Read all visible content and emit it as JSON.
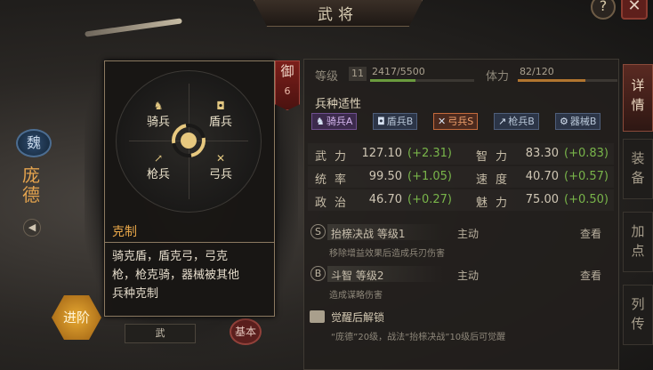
{
  "header": {
    "title": "武将"
  },
  "buttons": {
    "help": "?",
    "close": "✕"
  },
  "hero": {
    "faction": "魏",
    "name": "庞德",
    "advance_label": "进阶",
    "bottom_name": "武",
    "bottom_stamp": "基本"
  },
  "defense_badge": {
    "label": "御",
    "value": "6"
  },
  "tooltip": {
    "units": {
      "cavalry": {
        "icon": "horse-icon",
        "label": "骑兵"
      },
      "shield": {
        "icon": "shield-icon",
        "label": "盾兵"
      },
      "spear": {
        "icon": "spear-icon",
        "label": "枪兵"
      },
      "bow": {
        "icon": "bow-icon",
        "label": "弓兵"
      }
    },
    "title": "克制",
    "lines": [
      "骑克盾，盾克弓，弓克",
      "枪，枪克骑，器械被其他",
      "兵种克制"
    ]
  },
  "stats_header": {
    "level_label": "等级",
    "level": "11",
    "exp_text": "2417/5500",
    "exp_fraction": 0.44,
    "stamina_label": "体力",
    "stamina_text": "82/120",
    "stamina_fraction": 0.68
  },
  "affinity": {
    "title": "兵种适性",
    "chips": [
      {
        "icon": "horse-icon",
        "glyph": "♞",
        "label": "骑兵A",
        "grade": "A"
      },
      {
        "icon": "shield-icon",
        "glyph": "◘",
        "label": "盾兵B",
        "grade": "B"
      },
      {
        "icon": "bow-icon",
        "glyph": "✕",
        "label": "弓兵S",
        "grade": "S"
      },
      {
        "icon": "spear-icon",
        "glyph": "↗",
        "label": "枪兵B",
        "grade": "B"
      },
      {
        "icon": "machine-icon",
        "glyph": "⚙",
        "label": "器械B",
        "grade": "B"
      }
    ]
  },
  "stats": [
    {
      "name": "武力",
      "value": "127.10",
      "bonus": "(+2.31)"
    },
    {
      "name": "智力",
      "value": "83.30",
      "bonus": "(+0.83)"
    },
    {
      "name": "统率",
      "value": "99.50",
      "bonus": "(+1.05)"
    },
    {
      "name": "速度",
      "value": "40.70",
      "bonus": "(+0.57)"
    },
    {
      "name": "政治",
      "value": "46.70",
      "bonus": "(+0.27)"
    },
    {
      "name": "魅力",
      "value": "75.00",
      "bonus": "(+0.50)"
    }
  ],
  "skills": [
    {
      "grade": "S",
      "name": "抬榇决战 等级1",
      "type": "主动",
      "view": "查看",
      "desc": "移除增益效果后造成兵刃伤害"
    },
    {
      "grade": "B",
      "name": "斗智 等级2",
      "type": "主动",
      "view": "查看",
      "desc": "造成谋略伤害"
    }
  ],
  "awakening": {
    "title": "觉醒后解锁",
    "desc": "“庞德”20级，战法“抬榇决战”10级后可觉醒"
  },
  "tabs": [
    "详情",
    "装备",
    "加点",
    "列传"
  ]
}
